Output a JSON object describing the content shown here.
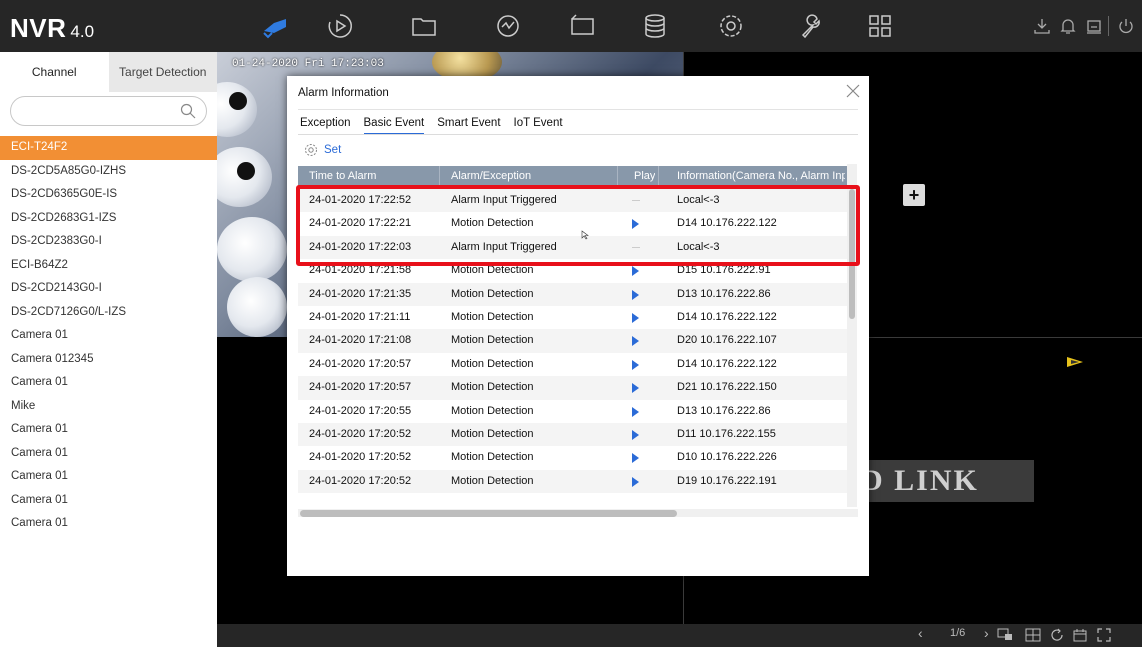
{
  "app": {
    "logo_main": "NVR",
    "logo_version": "4.0"
  },
  "topbar": {
    "icons": [
      "camera-icon",
      "playback-icon",
      "folder-icon",
      "smart-analysis-icon",
      "video-wall-icon",
      "storage-icon",
      "settings-gear-icon",
      "maintenance-wrench-icon",
      "grid-icon"
    ],
    "right_icons": [
      "download-icon",
      "bell-icon",
      "alarm-icon",
      "power-icon"
    ]
  },
  "left_panel": {
    "tabs": [
      "Channel",
      "Target Detection"
    ],
    "search_placeholder": "",
    "channels": [
      "ECI-T24F2",
      "DS-2CD5A85G0-IZHS",
      "DS-2CD6365G0E-IS",
      "DS-2CD2683G1-IZS",
      "DS-2CD2383G0-I",
      "ECI-B64Z2",
      "DS-2CD2143G0-I",
      "DS-2CD7126G0/L-IZS",
      "Camera 01",
      "Camera 012345",
      "Camera 01",
      "Mike",
      "Camera 01",
      "Camera 01",
      "Camera 01",
      "Camera 01",
      "Camera 01"
    ],
    "selected_index": 0
  },
  "video": {
    "osd_text": "01-24-2020 Fri 17:23:03",
    "watermark": "D LINK"
  },
  "bottombar": {
    "page": "1/6"
  },
  "dialog": {
    "title": "Alarm Information",
    "tabs": [
      "Exception",
      "Basic Event",
      "Smart Event",
      "IoT Event"
    ],
    "active_tab": "Basic Event",
    "set_label": "Set",
    "columns": [
      "Time to Alarm",
      "Alarm/Exception",
      "Play",
      "Information(Camera No., Alarm Input"
    ],
    "rows": [
      {
        "time": "24-01-2020 17:22:52",
        "event": "Alarm Input Triggered",
        "play": false,
        "info": "Local<-3"
      },
      {
        "time": "24-01-2020 17:22:21",
        "event": "Motion Detection",
        "play": true,
        "info": "D14  10.176.222.122"
      },
      {
        "time": "24-01-2020 17:22:03",
        "event": "Alarm Input Triggered",
        "play": false,
        "info": "Local<-3"
      },
      {
        "time": "24-01-2020 17:21:58",
        "event": "Motion Detection",
        "play": true,
        "info": "D15  10.176.222.91"
      },
      {
        "time": "24-01-2020 17:21:35",
        "event": "Motion Detection",
        "play": true,
        "info": "D13  10.176.222.86"
      },
      {
        "time": "24-01-2020 17:21:11",
        "event": "Motion Detection",
        "play": true,
        "info": "D14  10.176.222.122"
      },
      {
        "time": "24-01-2020 17:21:08",
        "event": "Motion Detection",
        "play": true,
        "info": "D20  10.176.222.107"
      },
      {
        "time": "24-01-2020 17:20:57",
        "event": "Motion Detection",
        "play": true,
        "info": "D14  10.176.222.122"
      },
      {
        "time": "24-01-2020 17:20:57",
        "event": "Motion Detection",
        "play": true,
        "info": "D21  10.176.222.150"
      },
      {
        "time": "24-01-2020 17:20:55",
        "event": "Motion Detection",
        "play": true,
        "info": "D13  10.176.222.86"
      },
      {
        "time": "24-01-2020 17:20:52",
        "event": "Motion Detection",
        "play": true,
        "info": "D11  10.176.222.155"
      },
      {
        "time": "24-01-2020 17:20:52",
        "event": "Motion Detection",
        "play": true,
        "info": "D10  10.176.222.226"
      },
      {
        "time": "24-01-2020 17:20:52",
        "event": "Motion Detection",
        "play": true,
        "info": "D19  10.176.222.191"
      }
    ],
    "highlight_color": "#e8101a",
    "accent_color": "#2b6bd7"
  }
}
